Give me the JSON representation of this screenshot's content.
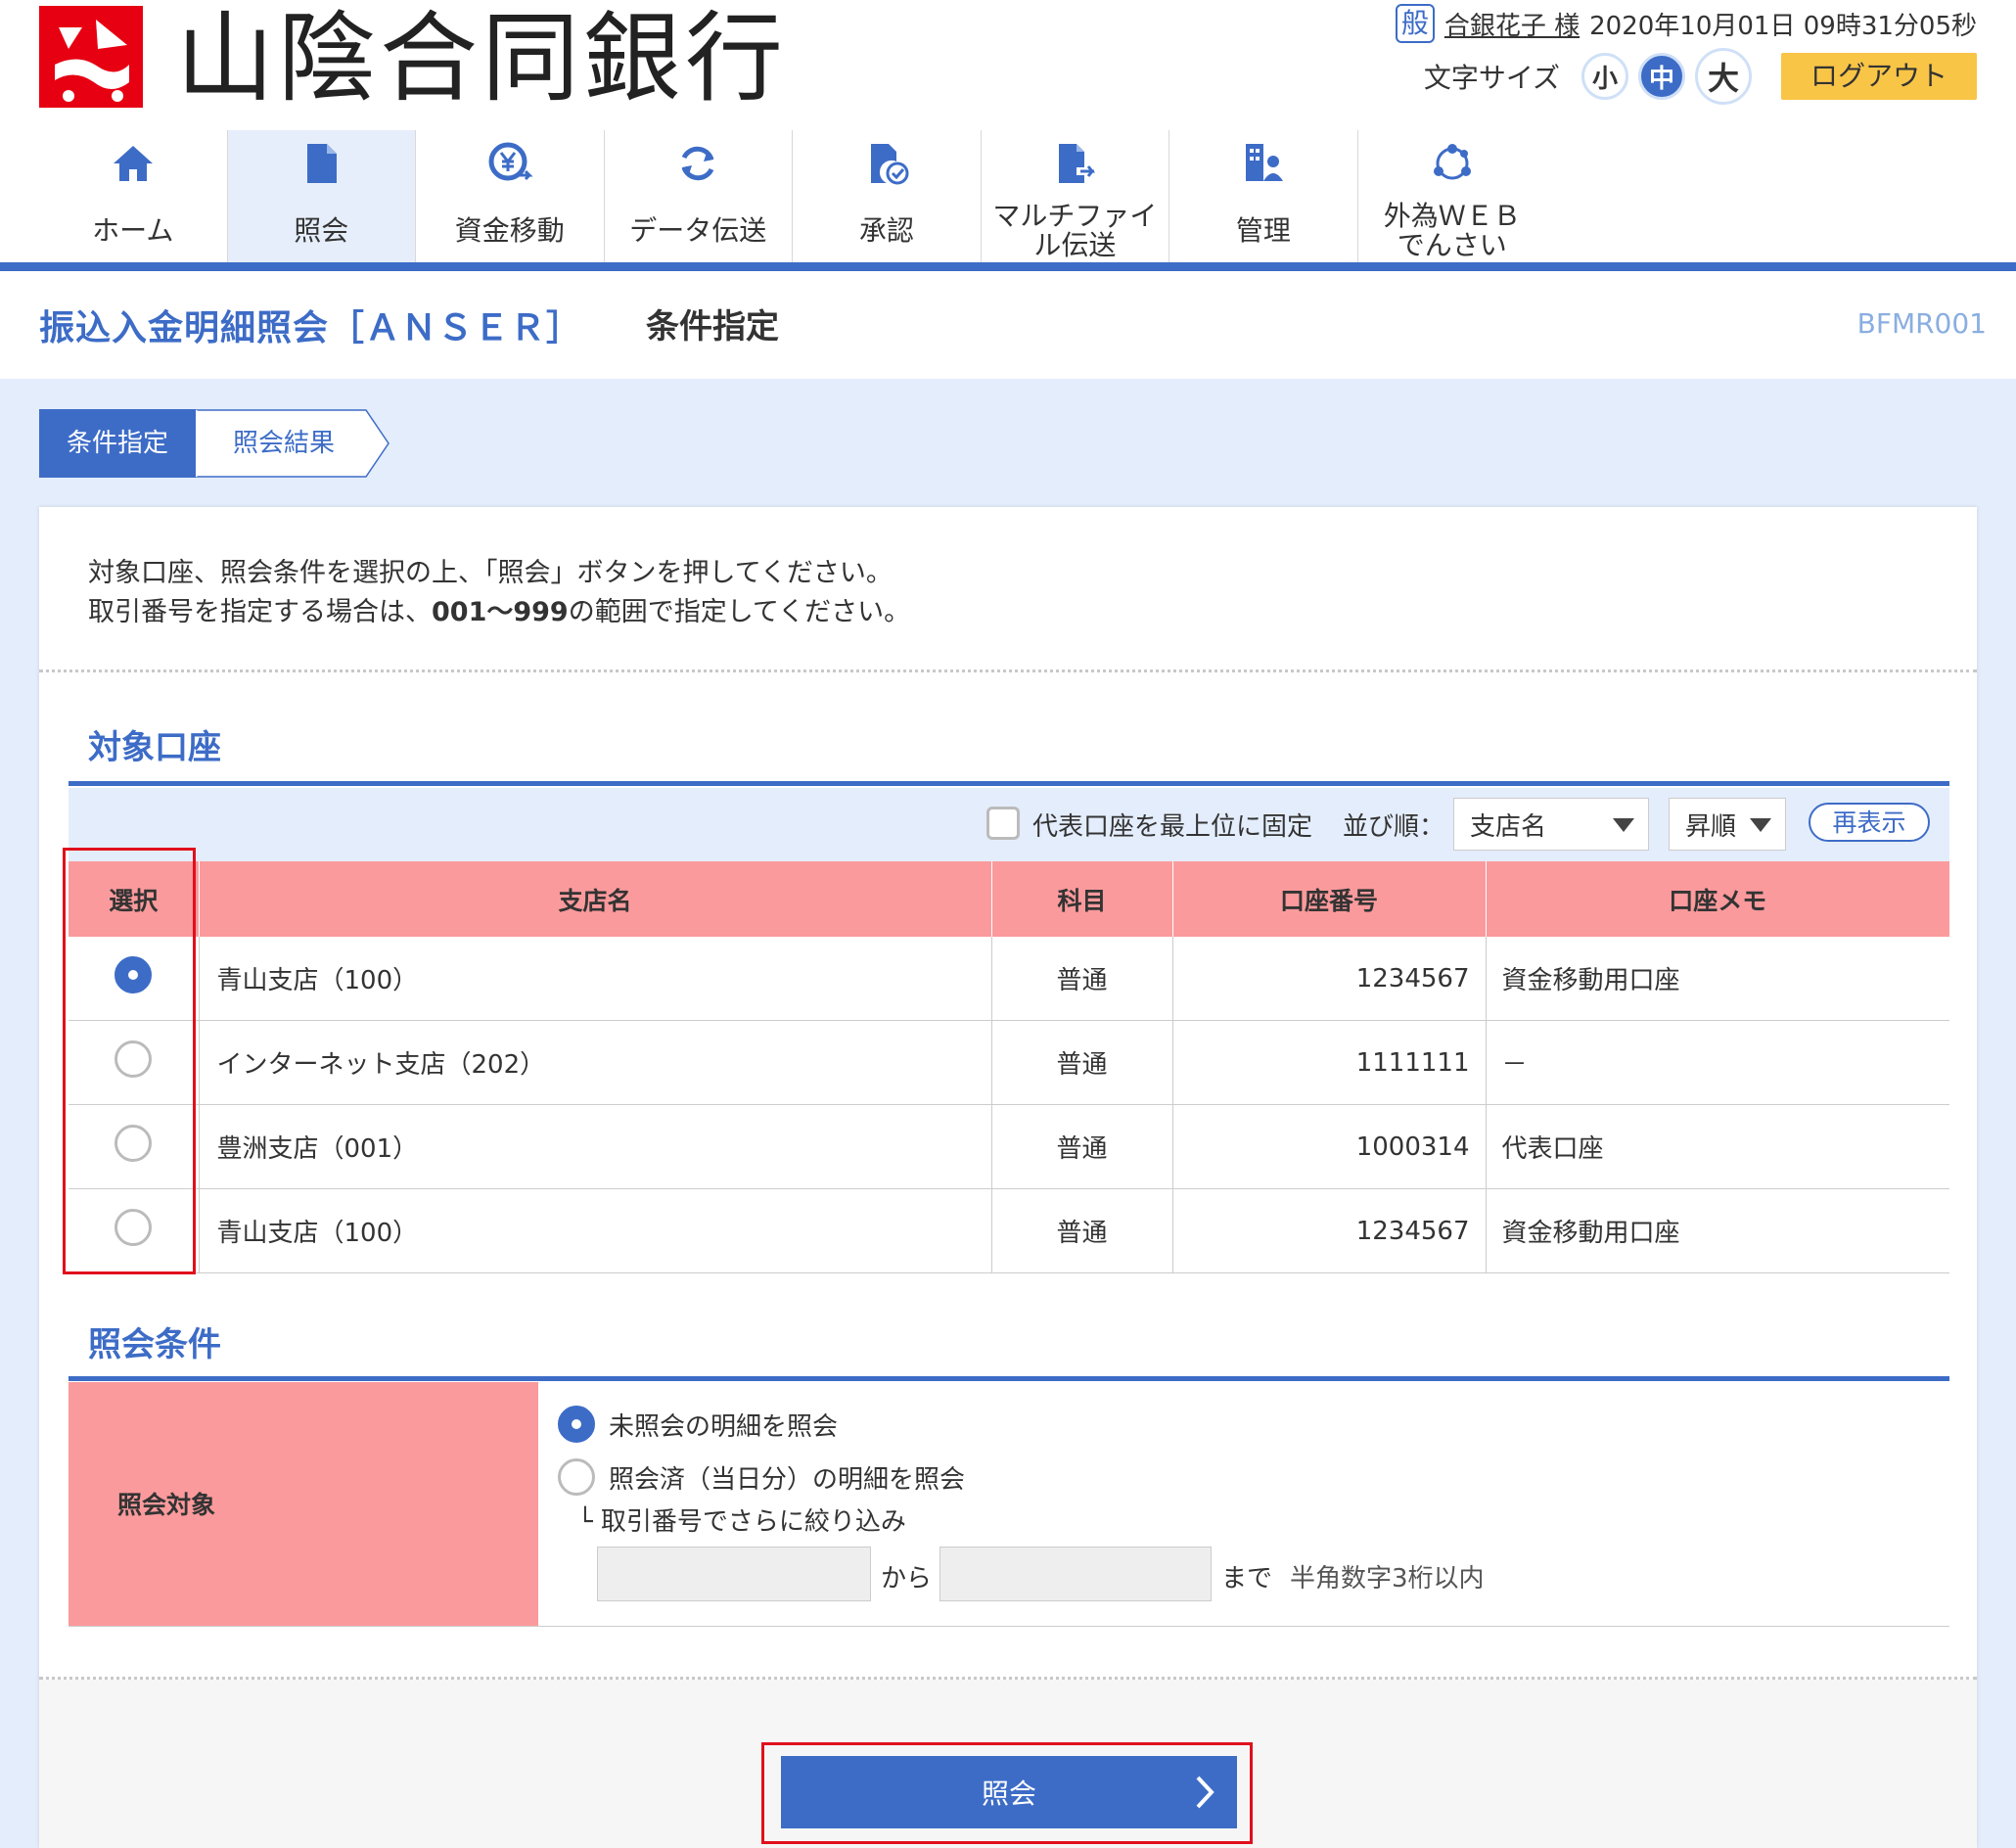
{
  "header": {
    "bank_name": "山陰合同銀行",
    "user_type": "般",
    "user_name": "合銀花子 様",
    "datetime": "2020年10月01日 09時31分05秒",
    "font_size_label": "文字サイズ",
    "font_sizes": [
      "小",
      "中",
      "大"
    ],
    "active_font_size": "中",
    "logout_label": "ログアウト"
  },
  "nav": {
    "items": [
      {
        "label": "ホーム",
        "icon": "home-icon"
      },
      {
        "label": "照会",
        "icon": "document-icon"
      },
      {
        "label": "資金移動",
        "icon": "yen-transfer-icon"
      },
      {
        "label": "データ伝送",
        "icon": "sync-icon"
      },
      {
        "label": "承認",
        "icon": "approval-icon"
      },
      {
        "label": "マルチファイル伝送",
        "icon": "file-transfer-icon"
      },
      {
        "label": "管理",
        "icon": "management-icon"
      },
      {
        "label": "外為ＷＥＢでんさい",
        "icon": "network-icon"
      }
    ],
    "active": "照会"
  },
  "page": {
    "title": "振込入金明細照会［ＡＮＳＥＲ］",
    "subtitle": "条件指定",
    "screen_id": "BFMR001"
  },
  "steps": {
    "current": "条件指定",
    "next": "照会結果"
  },
  "instructions": {
    "line1": "対象口座、照会条件を選択の上、「照会」ボタンを押してください。",
    "line2_pre": "取引番号を指定する場合は、",
    "line2_range": "001〜999",
    "line2_post": "の範囲で指定してください。"
  },
  "accounts_section": {
    "title": "対象口座",
    "fix_checkbox_label": "代表口座を最上位に固定",
    "fix_checked": false,
    "sort_label": "並び順：",
    "sort_value": "支店名",
    "order_value": "昇順",
    "redisplay_label": "再表示",
    "columns": [
      "選択",
      "支店名",
      "科目",
      "口座番号",
      "口座メモ"
    ],
    "rows": [
      {
        "selected": true,
        "branch": "青山支店（100）",
        "type": "普通",
        "number": "1234567",
        "memo": "資金移動用口座"
      },
      {
        "selected": false,
        "branch": "インターネット支店（202）",
        "type": "普通",
        "number": "1111111",
        "memo": "－"
      },
      {
        "selected": false,
        "branch": "豊洲支店（001）",
        "type": "普通",
        "number": "1000314",
        "memo": "代表口座"
      },
      {
        "selected": false,
        "branch": "青山支店（100）",
        "type": "普通",
        "number": "1234567",
        "memo": "資金移動用口座"
      }
    ]
  },
  "conditions_section": {
    "title": "照会条件",
    "row_label": "照会対象",
    "option1": "未照会の明細を照会",
    "option2": "照会済（当日分）の明細を照会",
    "option_selected": 1,
    "narrow_label": "└ 取引番号でさらに絞り込み",
    "from_value": "",
    "from_label": "から",
    "to_value": "",
    "to_label": "まで",
    "hint": "半角数字3桁以内"
  },
  "actions": {
    "inquiry_label": "照会"
  },
  "colors": {
    "primary": "#3d6cc7",
    "header_pink": "#fb9a9c",
    "logout_yellow": "#f9c547",
    "highlight_red": "#e0101c",
    "logo_red": "#e60012"
  }
}
